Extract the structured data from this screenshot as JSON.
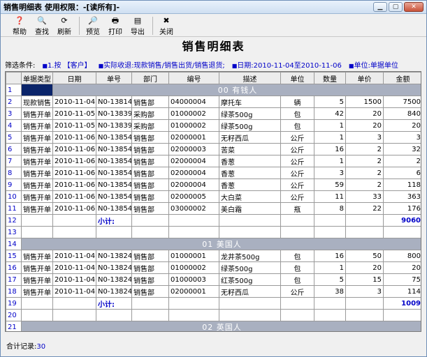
{
  "window": {
    "title": "销售明细表  使用权限：-[读所有]-"
  },
  "toolbar": [
    {
      "label": "帮助",
      "icon": "help-icon",
      "glyph": "❓"
    },
    {
      "label": "查找",
      "icon": "find-icon",
      "glyph": "🔍"
    },
    {
      "label": "刷新",
      "icon": "refresh-icon",
      "glyph": "⟳"
    },
    {
      "label": "预览",
      "icon": "preview-icon",
      "glyph": "🔎"
    },
    {
      "label": "打印",
      "icon": "print-icon",
      "glyph": "🖶"
    },
    {
      "label": "导出",
      "icon": "export-icon",
      "glyph": "▤"
    },
    {
      "label": "关闭",
      "icon": "close-icon",
      "glyph": "✖"
    }
  ],
  "report_title": "销售明细表",
  "filters": {
    "label": "筛选条件:",
    "group_by": "1.按 【客户】",
    "receipt": "实际收退:现款销售/销售出货/销售退货;",
    "date": "日期:2010-11-04至2010-11-06",
    "unit": "单位:单据单位"
  },
  "columns": [
    "单据类型",
    "日期",
    "单号",
    "部门",
    "编号",
    "描述",
    "单位",
    "数量",
    "单价",
    "金额"
  ],
  "rows": [
    {
      "n": "1",
      "type": "group",
      "text": "00  有钱人"
    },
    {
      "n": "2",
      "type": "data",
      "c": [
        "现款销售",
        "2010-11-04",
        "N0-13814",
        "销售部",
        "04000004",
        "摩托车",
        "辆",
        "5",
        "1500",
        "7500"
      ]
    },
    {
      "n": "3",
      "type": "data",
      "c": [
        "销售开单",
        "2010-11-05",
        "N0-13839",
        "采购部",
        "01000002",
        "绿茶500g",
        "包",
        "42",
        "20",
        "840"
      ]
    },
    {
      "n": "4",
      "type": "data",
      "c": [
        "销售开单",
        "2010-11-05",
        "N0-13839",
        "采购部",
        "01000002",
        "绿茶500g",
        "包",
        "1",
        "20",
        "20"
      ]
    },
    {
      "n": "5",
      "type": "data",
      "c": [
        "销售开单",
        "2010-11-06",
        "N0-13854",
        "销售部",
        "02000001",
        "无籽西瓜",
        "公斤",
        "1",
        "3",
        "3"
      ]
    },
    {
      "n": "6",
      "type": "data",
      "c": [
        "销售开单",
        "2010-11-06",
        "N0-13854",
        "销售部",
        "02000003",
        "苦菜",
        "公斤",
        "16",
        "2",
        "32"
      ]
    },
    {
      "n": "7",
      "type": "data",
      "c": [
        "销售开单",
        "2010-11-06",
        "N0-13854",
        "销售部",
        "02000004",
        "香葱",
        "公斤",
        "1",
        "2",
        "2"
      ]
    },
    {
      "n": "8",
      "type": "data",
      "c": [
        "销售开单",
        "2010-11-06",
        "N0-13854",
        "销售部",
        "02000004",
        "香葱",
        "公斤",
        "3",
        "2",
        "6"
      ]
    },
    {
      "n": "9",
      "type": "data",
      "c": [
        "销售开单",
        "2010-11-06",
        "N0-13854",
        "销售部",
        "02000004",
        "香葱",
        "公斤",
        "59",
        "2",
        "118"
      ]
    },
    {
      "n": "10",
      "type": "data",
      "c": [
        "销售开单",
        "2010-11-06",
        "N0-13854",
        "销售部",
        "02000005",
        "大白菜",
        "公斤",
        "11",
        "33",
        "363"
      ]
    },
    {
      "n": "11",
      "type": "data",
      "c": [
        "销售开单",
        "2010-11-06",
        "N0-13854",
        "销售部",
        "03000002",
        "美白霜",
        "瓶",
        "8",
        "22",
        "176"
      ]
    },
    {
      "n": "12",
      "type": "subtotal",
      "label": "小计:",
      "total": "9060"
    },
    {
      "n": "13",
      "type": "blank"
    },
    {
      "n": "14",
      "type": "group",
      "text": "01  美国人"
    },
    {
      "n": "15",
      "type": "data",
      "c": [
        "销售开单",
        "2010-11-04",
        "N0-13824",
        "销售部",
        "01000001",
        "龙井茶500g",
        "包",
        "16",
        "50",
        "800"
      ]
    },
    {
      "n": "16",
      "type": "data",
      "c": [
        "销售开单",
        "2010-11-04",
        "N0-13824",
        "销售部",
        "01000002",
        "绿茶500g",
        "包",
        "1",
        "20",
        "20"
      ]
    },
    {
      "n": "17",
      "type": "data",
      "c": [
        "销售开单",
        "2010-11-04",
        "N0-13824",
        "销售部",
        "01000003",
        "红茶500g",
        "包",
        "5",
        "15",
        "75"
      ]
    },
    {
      "n": "18",
      "type": "data",
      "c": [
        "销售开单",
        "2010-11-04",
        "N0-13824",
        "销售部",
        "02000001",
        "无籽西瓜",
        "公斤",
        "38",
        "3",
        "114"
      ]
    },
    {
      "n": "19",
      "type": "subtotal",
      "label": "小计:",
      "total": "1009"
    },
    {
      "n": "20",
      "type": "blank"
    },
    {
      "n": "21",
      "type": "group",
      "text": "02  英国人"
    }
  ],
  "status": {
    "label": "合计记录:",
    "count": "30"
  }
}
